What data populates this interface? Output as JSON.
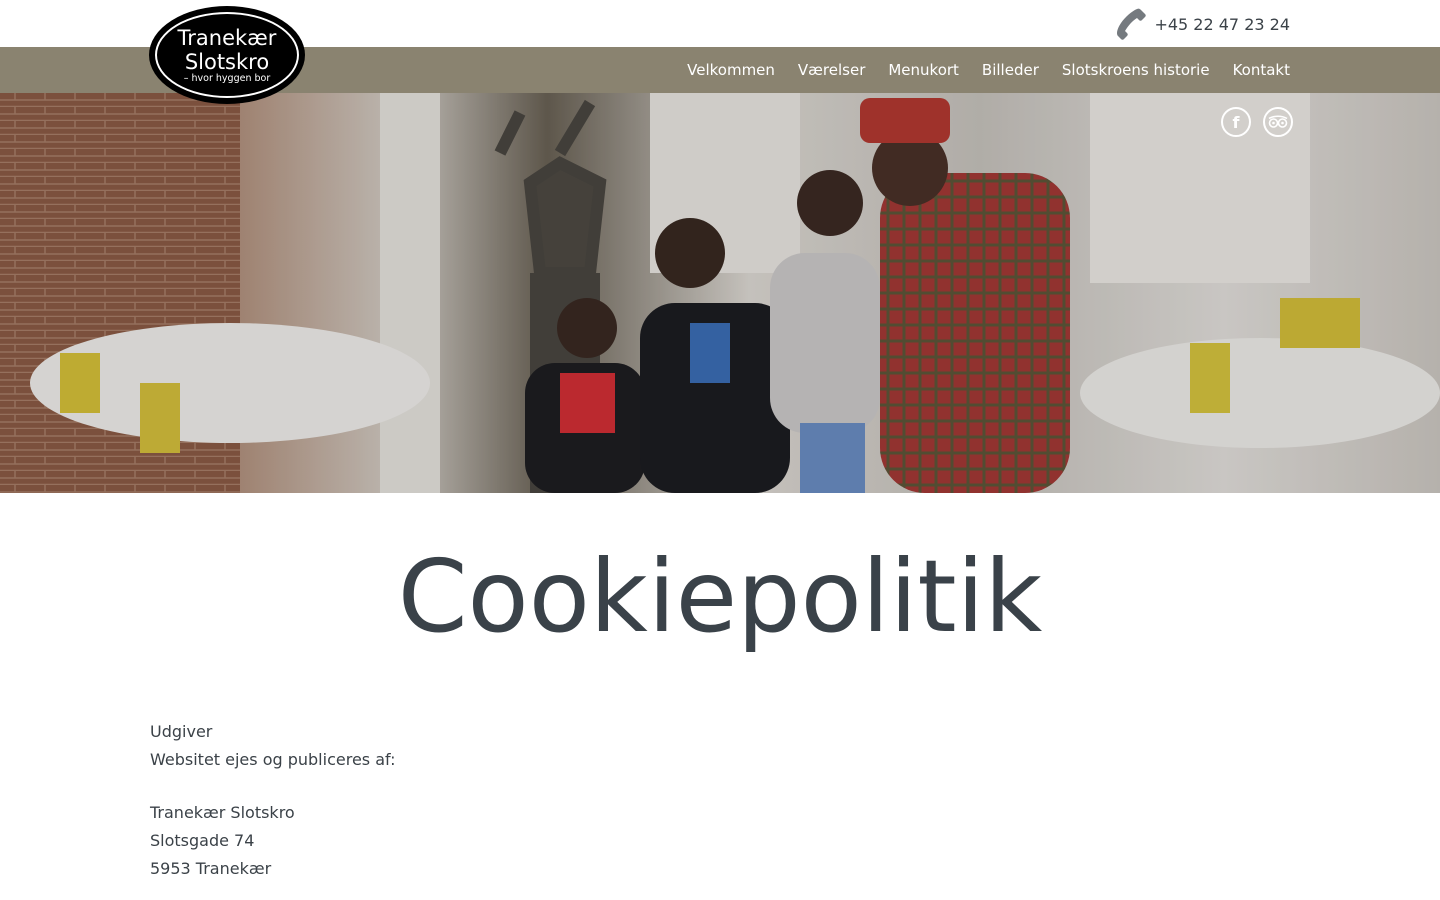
{
  "header": {
    "phone": "+45 22 47 23 24",
    "logo": {
      "line1": "Tranekær",
      "line2": "Slotskro",
      "tagline": "– hvor hyggen bor"
    },
    "nav": [
      {
        "label": "Velkommen"
      },
      {
        "label": "Værelser"
      },
      {
        "label": "Menukort"
      },
      {
        "label": "Billeder"
      },
      {
        "label": "Slotskroens historie"
      },
      {
        "label": "Kontakt"
      }
    ],
    "social": {
      "facebook_glyph": "f",
      "icons": [
        "facebook-icon",
        "tripadvisor-icon"
      ]
    }
  },
  "main": {
    "title": "Cookiepolitik",
    "publisher_heading": "Udgiver",
    "publisher_intro": "Websitet ejes og publiceres af:",
    "address": [
      "Tranekær Slotskro",
      "Slotsgade 74",
      "5953 Tranekær"
    ]
  },
  "colors": {
    "navbar": "#8a8370",
    "text": "#3b4248",
    "phone_icon": "#757a7f"
  }
}
